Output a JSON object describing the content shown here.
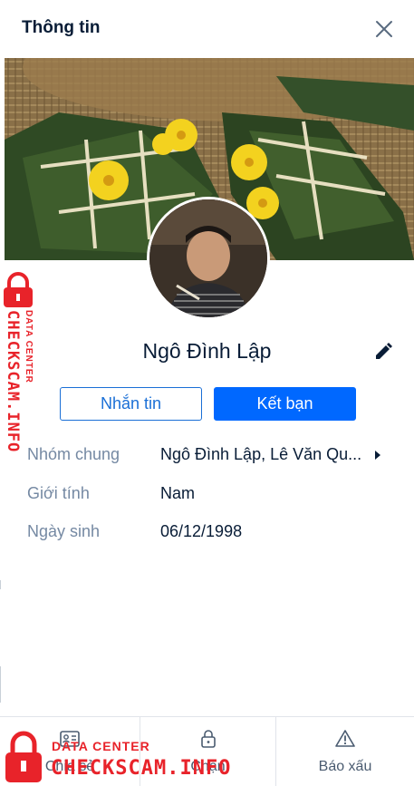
{
  "header": {
    "title": "Thông tin"
  },
  "profile": {
    "name": "Ngô Đình Lập",
    "message_label": "Nhắn tin",
    "add_friend_label": "Kết bạn"
  },
  "info": [
    {
      "label": "Nhóm chung",
      "value": "Ngô Đình Lập, Lê Văn Qu..."
    },
    {
      "label": "Giới tính",
      "value": "Nam"
    },
    {
      "label": "Ngày sinh",
      "value": "06/12/1998"
    }
  ],
  "footer": {
    "items": [
      {
        "label": "Chia sẻ",
        "icon": "card-icon"
      },
      {
        "label": "Chặn",
        "icon": "lock-icon"
      },
      {
        "label": "Báo xấu",
        "icon": "warning-icon"
      }
    ]
  },
  "watermark": {
    "top": "DATA CENTER",
    "main": "CHECKSCAM.INFO"
  },
  "colors": {
    "primary": "#0068ff",
    "text": "#081c36",
    "muted": "#7589a3",
    "watermark": "#e8232a"
  }
}
